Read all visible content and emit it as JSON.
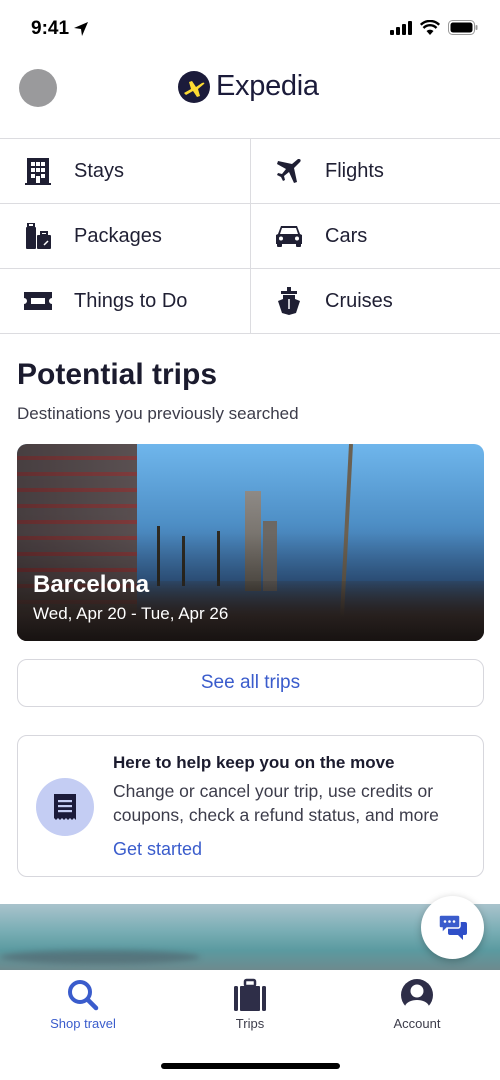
{
  "status_bar": {
    "time": "9:41",
    "icons": [
      "location-arrow-icon",
      "cellular-signal-icon",
      "wifi-icon",
      "battery-icon"
    ]
  },
  "header": {
    "brand": "Expedia",
    "avatar": "profile-avatar"
  },
  "categories": [
    {
      "label": "Stays",
      "icon": "building-icon"
    },
    {
      "label": "Flights",
      "icon": "airplane-icon"
    },
    {
      "label": "Packages",
      "icon": "luggage-icon"
    },
    {
      "label": "Cars",
      "icon": "car-icon"
    },
    {
      "label": "Things to Do",
      "icon": "ticket-icon"
    },
    {
      "label": "Cruises",
      "icon": "ship-icon"
    }
  ],
  "potential_trips": {
    "title": "Potential trips",
    "subtitle": "Destinations you previously searched",
    "trips": [
      {
        "city": "Barcelona",
        "dates": "Wed, Apr 20 - Tue, Apr 26"
      }
    ],
    "see_all_label": "See all trips"
  },
  "help_card": {
    "title": "Here to help keep you on the move",
    "body": "Change or cancel your trip, use credits or coupons, check a refund status, and more",
    "link": "Get started",
    "icon": "receipt-icon"
  },
  "chat_button": {
    "icon": "chat-bubbles-icon"
  },
  "bottom_nav": {
    "items": [
      {
        "label": "Shop travel",
        "icon": "search-icon",
        "active": true
      },
      {
        "label": "Trips",
        "icon": "briefcase-icon",
        "active": false
      },
      {
        "label": "Account",
        "icon": "account-icon",
        "active": false
      }
    ]
  },
  "colors": {
    "accent": "#3a5ccc",
    "brand_navy": "#1b1b3a",
    "brand_yellow": "#fddb32",
    "help_icon_bg": "#c4cdf3"
  }
}
